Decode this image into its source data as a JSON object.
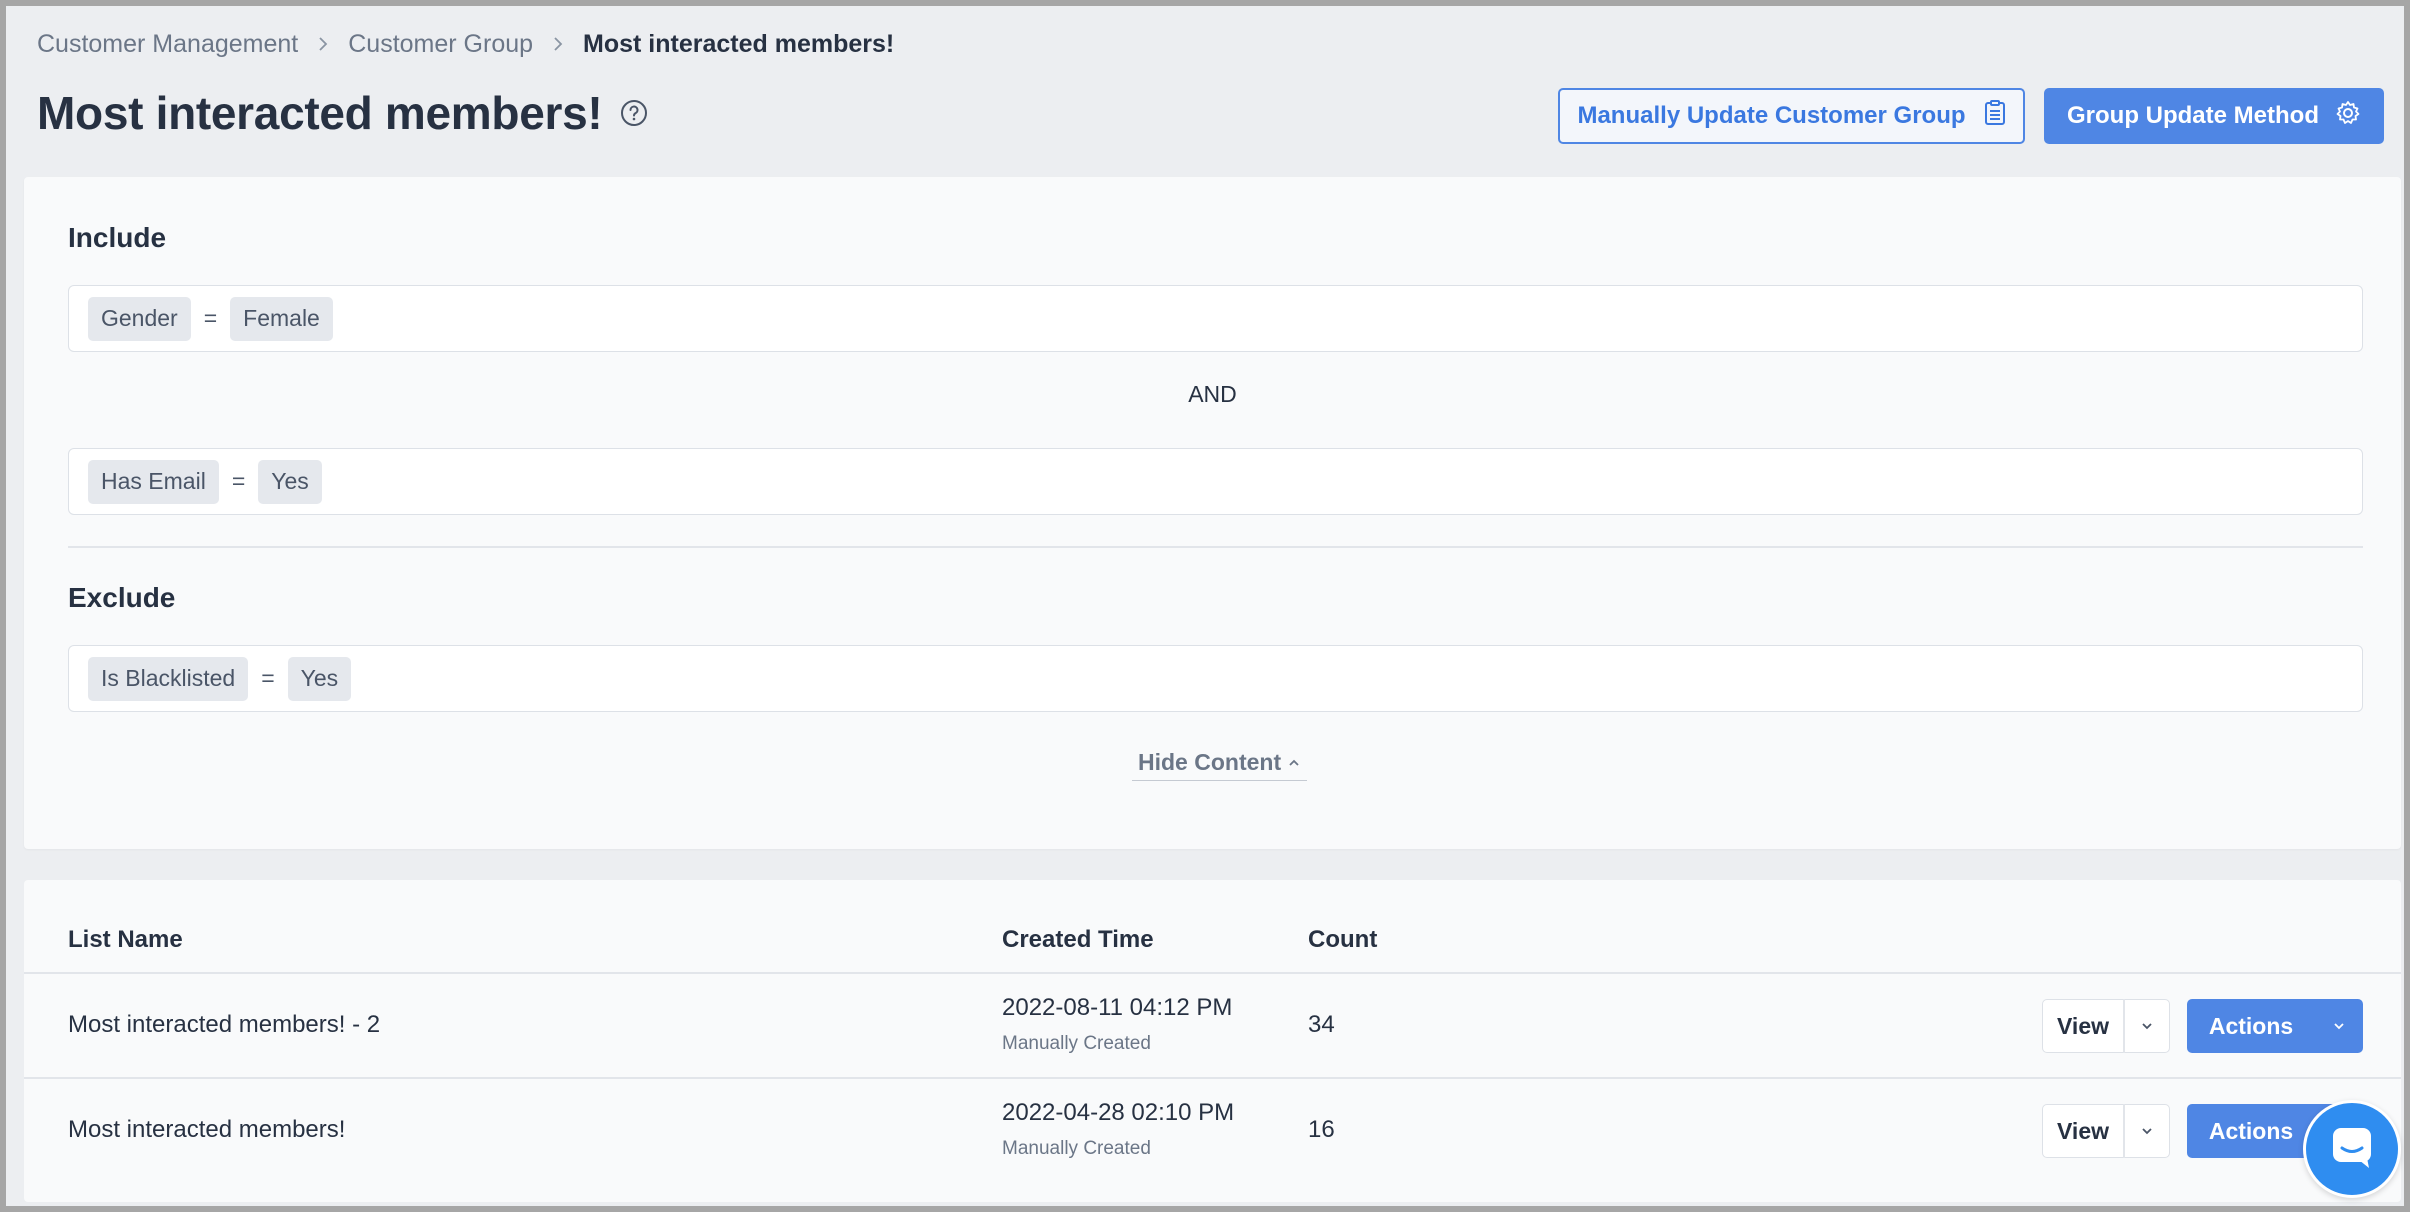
{
  "breadcrumb": {
    "items": [
      "Customer Management",
      "Customer Group",
      "Most interacted members!"
    ]
  },
  "header": {
    "title": "Most interacted members!",
    "manual_update_label": "Manually Update Customer Group",
    "update_method_label": "Group Update Method"
  },
  "criteria": {
    "include_title": "Include",
    "include": [
      {
        "field": "Gender",
        "op": "=",
        "value": "Female"
      },
      {
        "field": "Has Email",
        "op": "=",
        "value": "Yes"
      }
    ],
    "connector": "AND",
    "exclude_title": "Exclude",
    "exclude": [
      {
        "field": "Is Blacklisted",
        "op": "=",
        "value": "Yes"
      }
    ],
    "toggle_label": "Hide Content"
  },
  "table": {
    "columns": [
      "List Name",
      "Created Time",
      "Count"
    ],
    "rows": [
      {
        "name": "Most interacted members! - 2",
        "created": "2022-08-11 04:12 PM",
        "created_by": "Manually Created",
        "count": "34",
        "view_label": "View",
        "actions_label": "Actions"
      },
      {
        "name": "Most interacted members!",
        "created": "2022-04-28 02:10 PM",
        "created_by": "Manually Created",
        "count": "16",
        "view_label": "View",
        "actions_label": "Actions"
      }
    ]
  },
  "colors": {
    "accent": "#4f86e4",
    "background": "#eceef1",
    "card": "#f9fafb",
    "chat": "#2f8df0"
  },
  "icons": [
    "chevron-right-icon",
    "help-circle-icon",
    "clipboard-icon",
    "gear-icon",
    "chevron-up-icon",
    "chevron-down-icon",
    "chat-icon"
  ]
}
